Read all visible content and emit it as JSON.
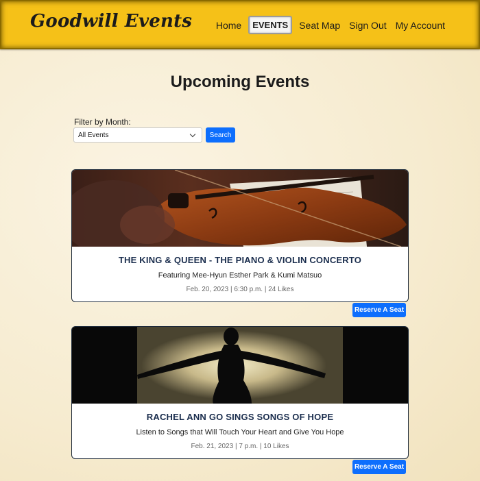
{
  "brand": "Goodwill Events",
  "nav": {
    "home": "Home",
    "events": "EVENTS",
    "seat_map": "Seat Map",
    "sign_out": "Sign Out",
    "my_account": "My Account"
  },
  "page_title": "Upcoming Events",
  "filter": {
    "label": "Filter by Month:",
    "selected": "All Events",
    "search_label": "Search"
  },
  "events": [
    {
      "title": "THE KING & QUEEN - THE PIANO & VIOLIN CONCERTO",
      "subtitle": "Featuring Mee-Hyun Esther Park & Kumi Matsuo",
      "meta": "Feb. 20, 2023 | 6:30 p.m. | 24 Likes",
      "button": "Reserve A Seat"
    },
    {
      "title": "RACHEL ANN GO SINGS SONGS OF HOPE",
      "subtitle": "Listen to Songs that Will Touch Your Heart and Give You Hope",
      "meta": "Feb. 21, 2023 | 7 p.m. | 10 Likes",
      "button": "Reserve A Seat"
    }
  ],
  "colors": {
    "navbar": "#f5c118",
    "accent": "#0d6efd",
    "title": "#1a2d4d"
  }
}
